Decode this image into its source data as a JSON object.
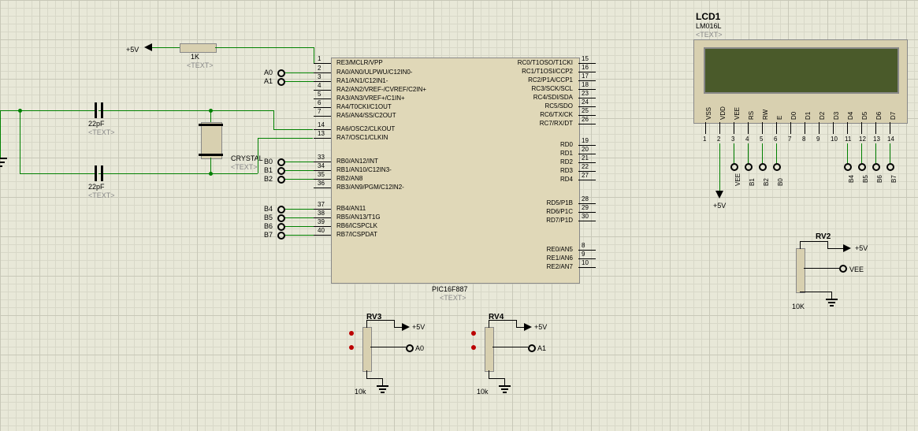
{
  "lcd": {
    "name": "LCD1",
    "part": "LM016L",
    "ph": "<TEXT>",
    "pins": [
      "VSS",
      "VDD",
      "VEE",
      "RS",
      "RW",
      "E",
      "D0",
      "D1",
      "D2",
      "D3",
      "D4",
      "D5",
      "D6",
      "D7"
    ],
    "nums": [
      "1",
      "2",
      "3",
      "4",
      "5",
      "6",
      "7",
      "8",
      "9",
      "10",
      "11",
      "12",
      "13",
      "14"
    ],
    "nets_a": [
      "VEE",
      "B1",
      "B2",
      "B0"
    ],
    "nets_b": [
      "B4",
      "B5",
      "B6",
      "B7"
    ],
    "pwr": "+5V"
  },
  "rv2": {
    "name": "RV2",
    "val": "10K",
    "pwr": "+5V",
    "net": "VEE"
  },
  "mcu": {
    "part": "PIC16F887",
    "ph": "<TEXT>",
    "left": [
      {
        "n": "1",
        "t": "RE3/MCLR/VPP"
      },
      {
        "n": "2",
        "t": "RA0/AN0/ULPWU/C12IN0-"
      },
      {
        "n": "3",
        "t": "RA1/AN1/C12IN1-"
      },
      {
        "n": "4",
        "t": "RA2/AN2/VREF-/CVREF/C2IN+"
      },
      {
        "n": "5",
        "t": "RA3/AN3/VREF+/C1IN+"
      },
      {
        "n": "6",
        "t": "RA4/T0CKI/C1OUT"
      },
      {
        "n": "7",
        "t": "RA5/AN4/SS/C2OUT"
      },
      {
        "n": "14",
        "t": "RA6/OSC2/CLKOUT"
      },
      {
        "n": "13",
        "t": "RA7/OSC1/CLKIN"
      },
      {
        "n": "33",
        "t": "RB0/AN12/INT"
      },
      {
        "n": "34",
        "t": "RB1/AN10/C12IN3-"
      },
      {
        "n": "35",
        "t": "RB2/AN8"
      },
      {
        "n": "36",
        "t": "RB3/AN9/PGM/C12IN2-"
      },
      {
        "n": "37",
        "t": "RB4/AN11"
      },
      {
        "n": "38",
        "t": "RB5/AN13/T1G"
      },
      {
        "n": "39",
        "t": "RB6/ICSPCLK"
      },
      {
        "n": "40",
        "t": "RB7/ICSPDAT"
      }
    ],
    "right": [
      {
        "n": "15",
        "t": "RC0/T1OSO/T1CKI"
      },
      {
        "n": "16",
        "t": "RC1/T1OSI/CCP2"
      },
      {
        "n": "17",
        "t": "RC2/P1A/CCP1"
      },
      {
        "n": "18",
        "t": "RC3/SCK/SCL"
      },
      {
        "n": "23",
        "t": "RC4/SDI/SDA"
      },
      {
        "n": "24",
        "t": "RC5/SDO"
      },
      {
        "n": "25",
        "t": "RC6/TX/CK"
      },
      {
        "n": "26",
        "t": "RC7/RX/DT"
      },
      {
        "n": "19",
        "t": "RD0"
      },
      {
        "n": "20",
        "t": "RD1"
      },
      {
        "n": "21",
        "t": "RD2"
      },
      {
        "n": "22",
        "t": "RD3"
      },
      {
        "n": "27",
        "t": "RD4"
      },
      {
        "n": "28",
        "t": "RD5/P1B"
      },
      {
        "n": "29",
        "t": "RD6/P1C"
      },
      {
        "n": "30",
        "t": "RD7/P1D"
      },
      {
        "n": "8",
        "t": "RE0/AN5"
      },
      {
        "n": "9",
        "t": "RE1/AN6"
      },
      {
        "n": "10",
        "t": "RE2/AN7"
      }
    ],
    "nets_left": [
      "A0",
      "A1",
      "B0",
      "B1",
      "B2",
      "B4",
      "B5",
      "B6",
      "B7"
    ]
  },
  "xtal": {
    "name": "CRYSTAL",
    "ph": "<TEXT>"
  },
  "c1": {
    "val": "22pF",
    "ph": "<TEXT>"
  },
  "c2": {
    "val": "22pF",
    "ph": "<TEXT>"
  },
  "r1": {
    "val": "1K",
    "ph": "<TEXT>"
  },
  "pwr": "+5V",
  "rv3": {
    "name": "RV3",
    "val": "10k",
    "pwr": "+5V",
    "net": "A0"
  },
  "rv4": {
    "name": "RV4",
    "val": "10k",
    "pwr": "+5V",
    "net": "A1"
  }
}
